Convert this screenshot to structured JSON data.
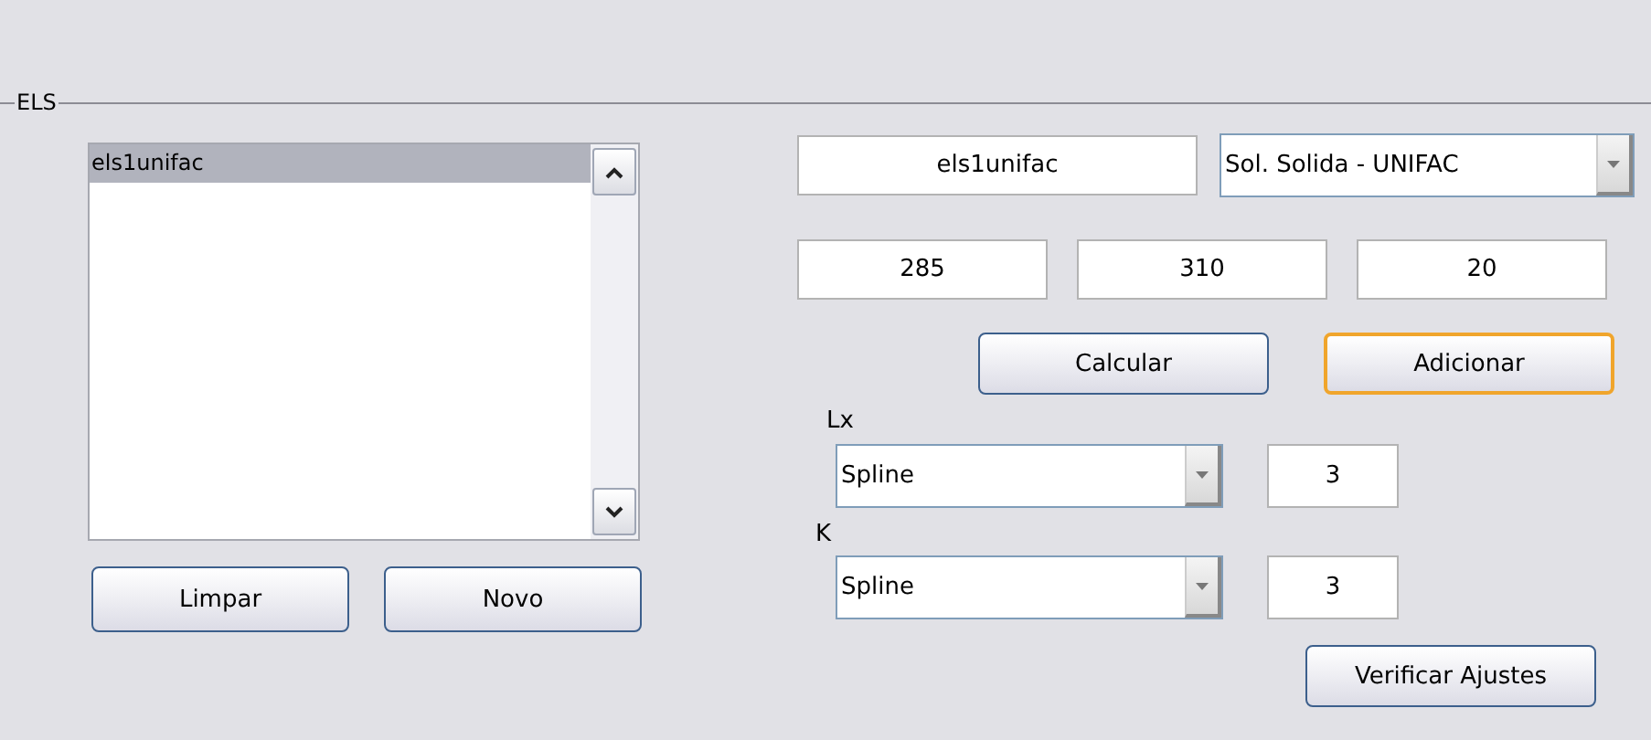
{
  "group": {
    "title": "ELS"
  },
  "list": {
    "items": [
      {
        "label": "els1unifac",
        "selected": true
      }
    ]
  },
  "list_buttons": [
    {
      "label": "Limpar",
      "default": false
    },
    {
      "label": "Novo",
      "default": false
    }
  ],
  "name_field": {
    "value": "els1unifac"
  },
  "model_select": {
    "value": "Sol. Solida - UNIFAC"
  },
  "range_fields": [
    {
      "value": "285"
    },
    {
      "value": "310"
    },
    {
      "value": "20"
    }
  ],
  "action_buttons": [
    {
      "label": "Calcular",
      "default": false
    },
    {
      "label": "Adicionar",
      "default": true
    }
  ],
  "fits": [
    {
      "label": "Lx",
      "method": "Spline",
      "order": "3"
    },
    {
      "label": "K",
      "method": "Spline",
      "order": "3"
    }
  ],
  "verify_button": {
    "label": "Verificar Ajustes",
    "default": false
  }
}
